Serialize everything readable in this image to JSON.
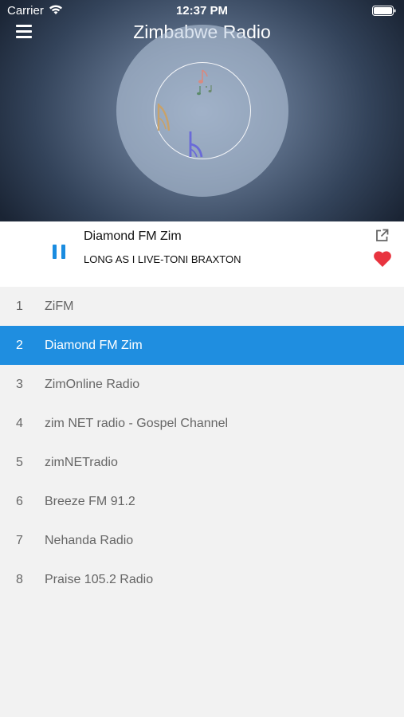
{
  "status_bar": {
    "carrier": "Carrier",
    "time": "12:37 PM"
  },
  "header": {
    "title": "Zimbabwe Radio",
    "menu_icon": "menu-icon"
  },
  "now_playing": {
    "station": "Diamond FM Zim",
    "track": "LONG AS I LIVE-TONI BRAXTON",
    "state": "playing",
    "favorited": true
  },
  "stations": [
    {
      "num": "1",
      "name": "ZiFM",
      "selected": false
    },
    {
      "num": "2",
      "name": "Diamond FM Zim",
      "selected": true
    },
    {
      "num": "3",
      "name": "ZimOnline Radio",
      "selected": false
    },
    {
      "num": "4",
      "name": "zim NET radio - Gospel Channel",
      "selected": false
    },
    {
      "num": "5",
      "name": "zimNETradio",
      "selected": false
    },
    {
      "num": "6",
      "name": "Breeze FM 91.2",
      "selected": false
    },
    {
      "num": "7",
      "name": "Nehanda Radio",
      "selected": false
    },
    {
      "num": "8",
      "name": "Praise 105.2 Radio",
      "selected": false
    }
  ],
  "colors": {
    "accent": "#1f8ee0",
    "heart": "#e8343f",
    "list_text": "#666666"
  }
}
